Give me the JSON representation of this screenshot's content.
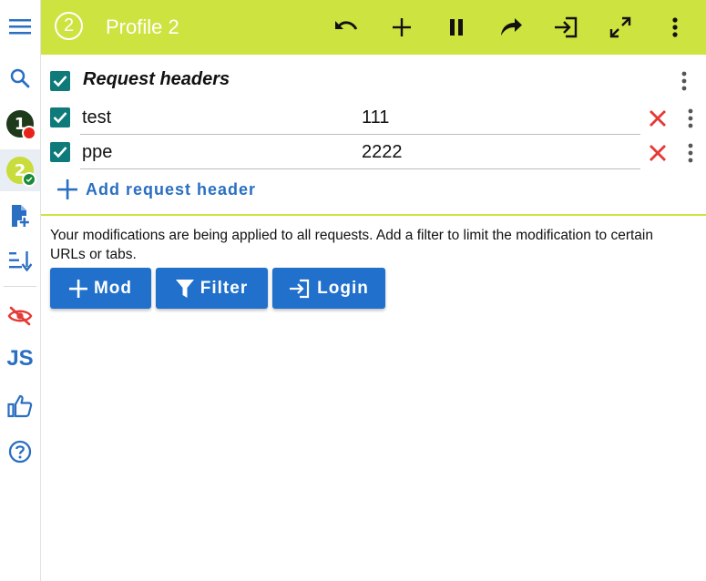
{
  "topbar": {
    "profile_number": "2",
    "title": "Profile 2",
    "buttons": [
      "undo-icon",
      "add-icon",
      "pause-icon",
      "redo-icon",
      "login-icon",
      "fullscreen-icon",
      "more-vert-icon"
    ]
  },
  "sidebar": {
    "profiles": [
      {
        "number": "1",
        "color": "#1e3a1a",
        "badge_color": "#e8231c"
      },
      {
        "number": "2",
        "color": "#c8dc3c",
        "badge_color": "#1a8a3a"
      }
    ],
    "js_label": "JS"
  },
  "section": {
    "title": "Request headers",
    "enabled": true
  },
  "headers": [
    {
      "name": "test",
      "value": "111",
      "enabled": true
    },
    {
      "name": "ppe",
      "value": "2222",
      "enabled": true
    }
  ],
  "add_header_label": "Add request header",
  "info_text": "Your modifications are being applied to all requests. Add a filter to limit the modification to certain URLs or tabs.",
  "buttons": {
    "mod": "Mod",
    "filter": "Filter",
    "login": "Login"
  },
  "colors": {
    "accent_yellow": "#cde33f",
    "primary_blue": "#2070cc",
    "checkbox_teal": "#0f7a7a",
    "delete_red": "#e53935"
  }
}
